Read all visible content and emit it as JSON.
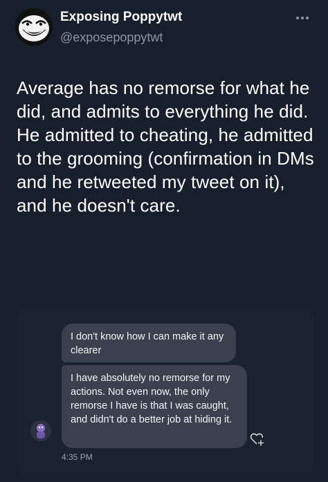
{
  "tweet": {
    "display_name": "Exposing Poppytwt",
    "handle": "@exposepoppytwt",
    "text": "Average has no remorse for what he did, and admits to everything he did. He admitted to cheating, he admitted to the grooming (confirmation in DMs and he retweeted my tweet on it), and he doesn't care."
  },
  "dm_screenshot": {
    "messages": [
      "I don't know how I can make it any clearer",
      "I have absolutely no remorse for my actions. Not even now, the only remorse I have is that I was caught, and didn't do a better job at hiding it."
    ],
    "timestamp": "4:35 PM"
  },
  "icons": {
    "avatar": "trollface-avatar-icon",
    "more": "more-dots-icon",
    "dm_avatar": "purple-character-avatar-icon",
    "react": "heart-plus-icon"
  },
  "colors": {
    "background": "#161f2b",
    "secondary_text": "#8b98a5",
    "bubble": "#3a404e"
  }
}
